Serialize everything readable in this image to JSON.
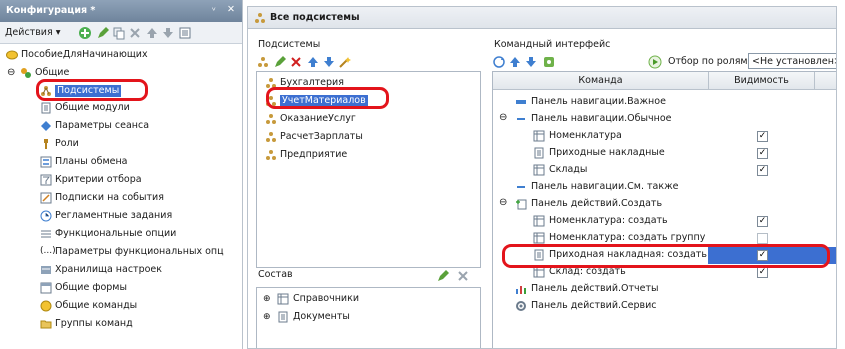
{
  "left": {
    "title": "Конфигурация *",
    "title_controls": [
      "ⱽ",
      "✕"
    ],
    "actions_label": "Действия ▾",
    "root": "ПособиеДляНачинающих",
    "general": "Общие",
    "items": [
      "Подсистемы",
      "Общие модули",
      "Параметры сеанса",
      "Роли",
      "Планы обмена",
      "Критерии отбора",
      "Подписки на события",
      "Регламентные задания",
      "Функциональные опции",
      "Параметры функциональных опц",
      "Хранилища настроек",
      "Общие формы",
      "Общие команды",
      "Группы команд"
    ]
  },
  "right": {
    "title": "Все подсистемы",
    "subsystems_label": "Подсистемы",
    "subsystems": [
      "Бухгалтерия",
      "УчетМатериалов",
      "ОказаниеУслуг",
      "РасчетЗарплаты",
      "Предприятие"
    ],
    "composition_label": "Состав",
    "composition": [
      "Справочники",
      "Документы"
    ],
    "cmd_label": "Командный интерфейс",
    "filter_label": "Отбор по ролям:",
    "filter_value": "<Не установлен>",
    "col_command": "Команда",
    "col_visibility": "Видимость",
    "rows": [
      {
        "text": "Панель навигации.Важное",
        "check": ""
      },
      {
        "text": "Панель навигации.Обычное",
        "check": ""
      },
      {
        "text": "Номенклатура",
        "check": "✓"
      },
      {
        "text": "Приходные накладные",
        "check": "✓"
      },
      {
        "text": "Склады",
        "check": "✓"
      },
      {
        "text": "Панель навигации.См. также",
        "check": ""
      },
      {
        "text": "Панель действий.Создать",
        "check": ""
      },
      {
        "text": "Номенклатура: создать",
        "check": "✓"
      },
      {
        "text": "Номенклатура: создать группу",
        "check": ""
      },
      {
        "text": "Приходная накладная: создать",
        "check": "✓"
      },
      {
        "text": "Склад: создать",
        "check": "✓"
      },
      {
        "text": "Панель действий.Отчеты",
        "check": ""
      },
      {
        "text": "Панель действий.Сервис",
        "check": ""
      }
    ]
  },
  "colors": {
    "selection": "#3c6fd1",
    "highlight_oval": "#e3141b",
    "panel_title": "#7f93aa"
  }
}
